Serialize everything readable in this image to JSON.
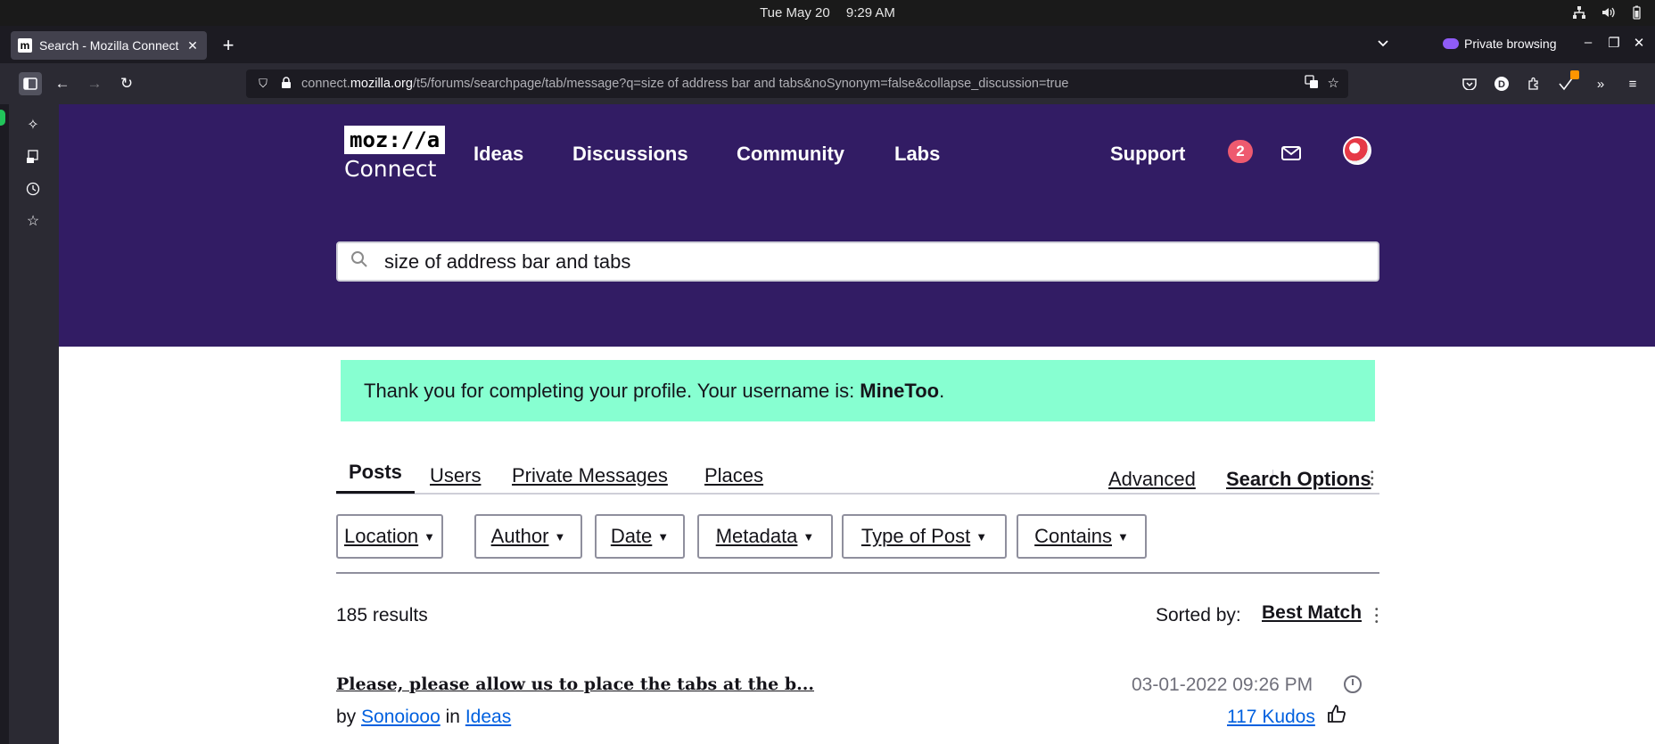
{
  "os": {
    "date": "Tue May 20",
    "time": "9:29 AM"
  },
  "browser": {
    "tab_title": "Search - Mozilla Connect",
    "tab_favicon": "m",
    "private_label": "Private browsing",
    "url_prefix": "connect.",
    "url_domain": "mozilla.org",
    "url_path": "/t5/forums/searchpage/tab/message?q=size of address bar and tabs&noSynonym=false&collapse_discussion=true"
  },
  "site": {
    "logo_top": "moz://a",
    "logo_bottom": "Connect",
    "nav": [
      "Ideas",
      "Discussions",
      "Community",
      "Labs"
    ],
    "support": "Support",
    "notification_count": "2",
    "search_value": "size of address bar and tabs"
  },
  "banner": {
    "text": "Thank you for completing your profile. Your username is:",
    "username": "MineToo",
    "period": "."
  },
  "search_tabs": {
    "items": [
      "Posts",
      "Users",
      "Private Messages",
      "Places"
    ],
    "active": "Posts",
    "advanced": "Advanced",
    "search_options": "Search Options"
  },
  "filters": [
    "Location",
    "Author",
    "Date",
    "Metadata",
    "Type of Post",
    "Contains"
  ],
  "results": {
    "count": "185 results",
    "sorted_by_label": "Sorted by:",
    "sorted_by_value": "Best Match",
    "items": [
      {
        "title": "Please, please allow us to place the tabs at the b...",
        "date": "03-01-2022 09:26 PM",
        "by_label": "by",
        "author": "Sonoiooo",
        "in_label": "in",
        "board": "Ideas",
        "kudos": "117 Kudos"
      }
    ]
  },
  "icons": {
    "sidebar": [
      "ai-sparkle-icon",
      "synced-tabs-icon",
      "history-icon",
      "bookmarks-icon"
    ],
    "toolbar": [
      "pocket-icon",
      "account-icon",
      "extensions-icon",
      "extension-badge-icon",
      "overflow-icon",
      "menu-icon"
    ]
  }
}
